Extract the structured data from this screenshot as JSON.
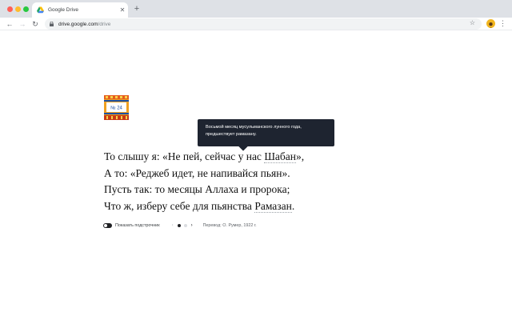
{
  "browser": {
    "tab_title": "Google Drive",
    "url_host": "drive.google.com",
    "url_path": "/drive"
  },
  "poster": {
    "label": "№ 24"
  },
  "poem": {
    "lines": [
      {
        "before": "То слышу я: «Не пей, сейчас у нас ",
        "gloss": "Шабан",
        "after": "»,"
      },
      {
        "text": "А то: «Реджеб идет, не напивайся пьян»."
      },
      {
        "text": "Пусть так: то месяцы Аллаха и пророка;"
      },
      {
        "before": "Что ж, изберу себе для пьянства ",
        "gloss": "Рамазан",
        "after": "."
      }
    ]
  },
  "tooltip": {
    "text": "Восьмой месяц мусульманского лунного года, предшествует рамазану."
  },
  "controls": {
    "toggle_label": "Показать подстрочник",
    "pager": {
      "prev_icon": "‹",
      "next_icon": "›",
      "pages": 2,
      "current": 1
    },
    "credit": "Перевод: О. Румер, 1922 г."
  },
  "colors": {
    "tab_strip": "#dee1e6",
    "tooltip_bg": "#1e2430",
    "poster_bg": "#f0a020"
  },
  "icons": [
    "close-icon",
    "plus-icon",
    "back-arrow-icon",
    "forward-arrow-icon",
    "reload-icon",
    "lock-icon",
    "star-icon",
    "kebab-menu-icon"
  ]
}
